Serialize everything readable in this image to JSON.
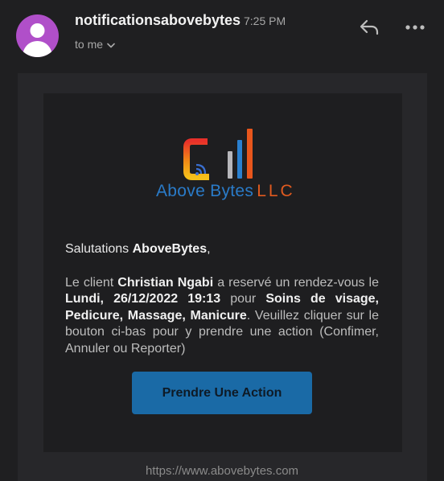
{
  "header": {
    "sender": "notificationsabovebytes",
    "time": "7:25 PM",
    "recipient_label": "to me",
    "icons": {
      "avatar": "person-avatar-icon",
      "recipient_toggle": "chevron-down-icon",
      "reply": "reply-icon",
      "more": "more-options-icon"
    },
    "avatar_color": "#b04fc9"
  },
  "email": {
    "logo": {
      "brand": "Above Bytes",
      "suffix": "LLC"
    },
    "greeting_prefix": "Salutations ",
    "greeting_name": "AboveBytes",
    "greeting_suffix": ",",
    "message": {
      "p1": "Le client ",
      "client": "Christian Ngabi",
      "p2": " a reservé un rendez-vous le ",
      "date": "Lundi, 26/12/2022 19:13",
      "p3": " pour ",
      "services": "Soins de visage, Pedicure, Massage, Manicure",
      "p4": ". Veuillez cliquer sur le bouton ci-bas pour y prendre une action (Confimer, Annuler ou Reporter)"
    },
    "action_button_label": "Prendre Une Action",
    "button_color": "#1a6aa6",
    "footer_link": "https://www.abovebytes.com"
  }
}
